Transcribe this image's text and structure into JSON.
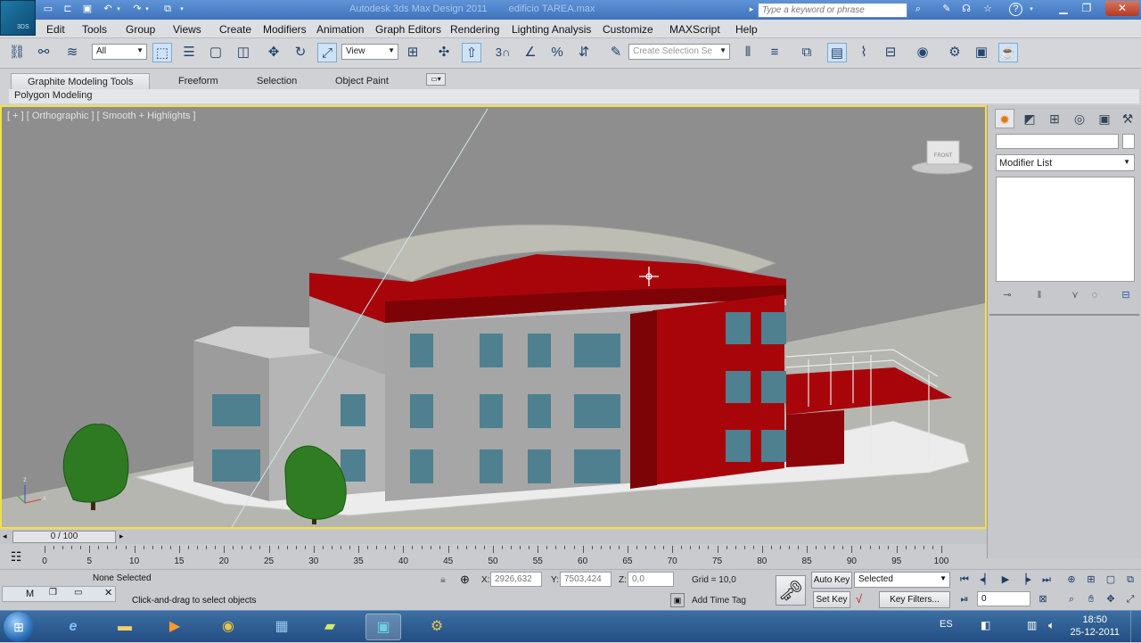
{
  "window": {
    "title": "Autodesk 3ds Max Design 2011",
    "file": "edificio TAREA.max",
    "app_badge": "3DS",
    "search_placeholder": "Type a keyword or phrase"
  },
  "menu": [
    "Edit",
    "Tools",
    "Group",
    "Views",
    "Create",
    "Modifiers",
    "Animation",
    "Graph Editors",
    "Rendering",
    "Lighting Analysis",
    "Customize",
    "MAXScript",
    "Help"
  ],
  "toolbar": {
    "filter_value": "All",
    "refcoord_value": "View",
    "selection_set_placeholder": "Create Selection Se",
    "snap_label": "3"
  },
  "ribbon": {
    "tabs": [
      "Graphite Modeling Tools",
      "Freeform",
      "Selection",
      "Object Paint"
    ],
    "panel": "Polygon Modeling"
  },
  "viewport": {
    "label": "[ + ] [ Orthographic ] [ Smooth + Highlights ]",
    "viewcube_face": "FRONT",
    "axis_z": "z",
    "axis_x": "x"
  },
  "command_panel": {
    "modifier_list": "Modifier List"
  },
  "timeline": {
    "frame": "0 / 100",
    "ticks": [
      0,
      5,
      10,
      15,
      20,
      25,
      30,
      35,
      40,
      45,
      50,
      55,
      60,
      65,
      70,
      75,
      80,
      85,
      90,
      95,
      100
    ]
  },
  "status": {
    "selection": "None Selected",
    "prompt": "Click-and-drag to select objects",
    "maxscript_label": "M",
    "x_label": "X:",
    "x_value": "2926,632",
    "y_label": "Y:",
    "y_value": "7503,424",
    "z_label": "Z:",
    "z_value": "0,0",
    "grid": "Grid = 10,0",
    "add_time_tag": "Add Time Tag",
    "auto_key": "Auto Key",
    "key_mode": "Selected",
    "set_key": "Set Key",
    "key_filters": "Key Filters...",
    "frame_value": "0"
  },
  "taskbar": {
    "language": "ES",
    "time": "18:50",
    "date": "25-12-2011"
  },
  "colors": {
    "viewport_bg": "#8f8f90",
    "active_viewport_border": "#f4e040",
    "building_red": "#a8050b",
    "building_gray": "#a9a9a9",
    "glass": "#4e8090",
    "tree_green": "#2e7a22"
  }
}
